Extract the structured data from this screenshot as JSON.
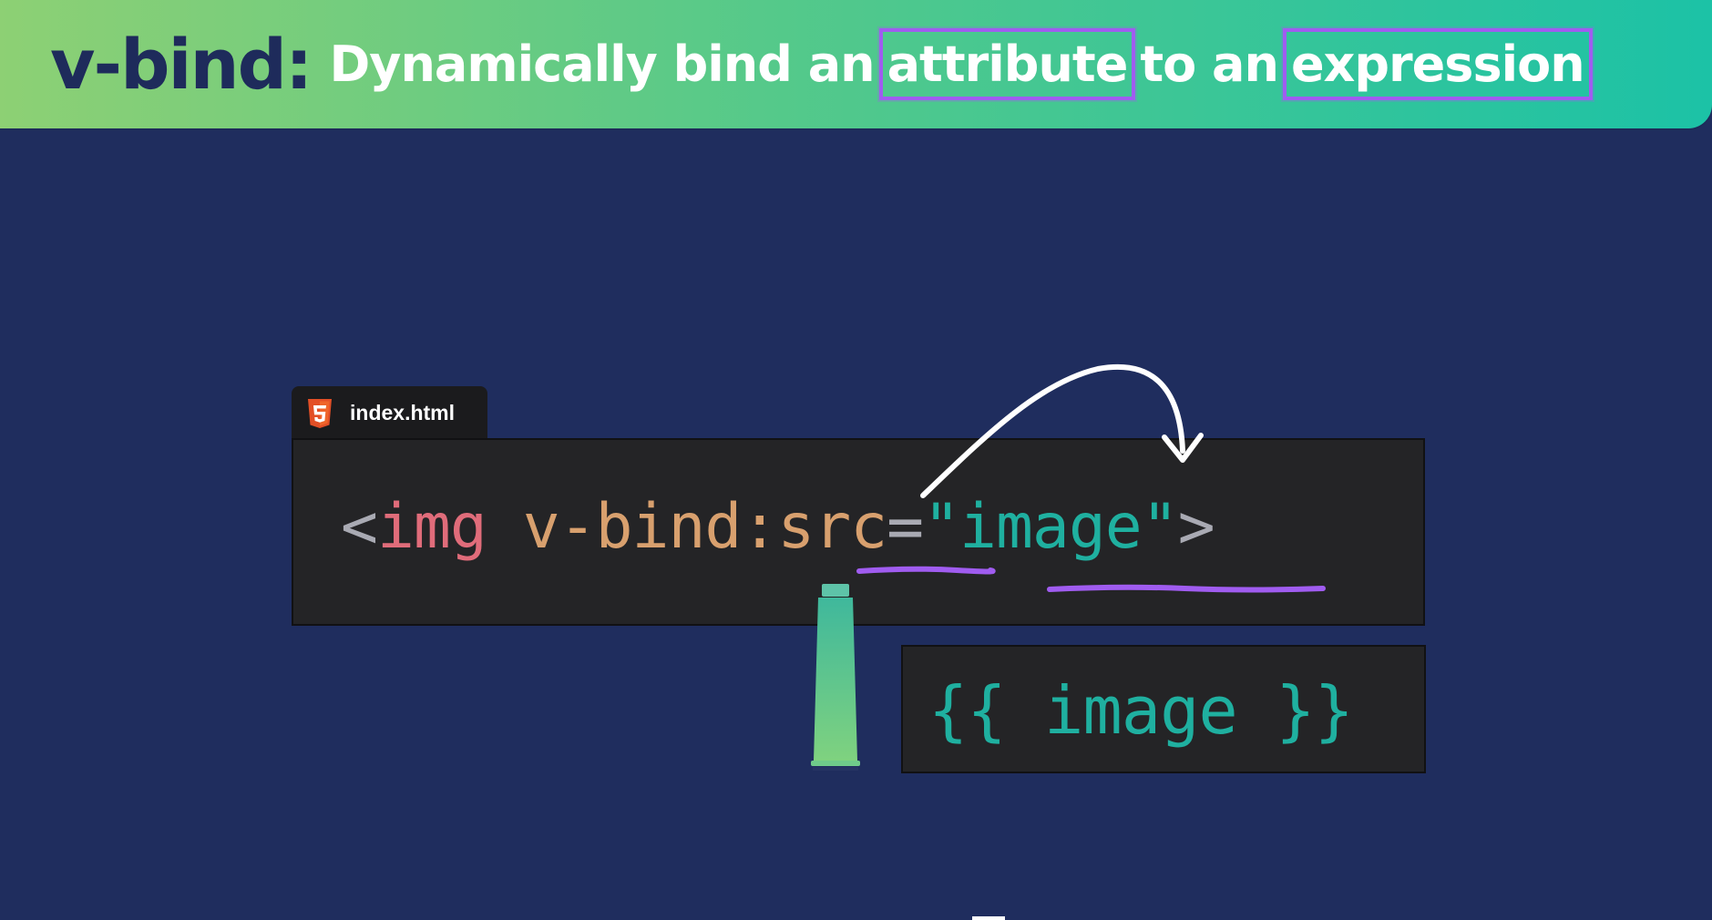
{
  "header": {
    "directive": "v-bind:",
    "words": [
      "Dynamically",
      "bind",
      "an"
    ],
    "highlight_1": "attribute",
    "middle": "to an",
    "highlight_2": "expression"
  },
  "editor": {
    "file_icon": "html5-icon",
    "file_name": "index.html",
    "code": {
      "open_bracket": "<",
      "tag": "img",
      "directive": "v-bind:",
      "attribute": "src",
      "equals": "=",
      "quote_open": "\"",
      "value": "image",
      "quote_close": "\"",
      "close_bracket": ">"
    }
  },
  "expression_panel": {
    "text": "{{ image }}"
  },
  "colors": {
    "background": "#1f2d5e",
    "banner_gradient": [
      "#8dd074",
      "#1cc2a6"
    ],
    "highlight_purple": "#a05cf0",
    "tag_pink": "#e06c7a",
    "directive_tan": "#d8a06e",
    "value_teal": "#1fb0a0",
    "glue_tube_gradient": [
      "#3fb89c",
      "#7fd27f"
    ]
  }
}
